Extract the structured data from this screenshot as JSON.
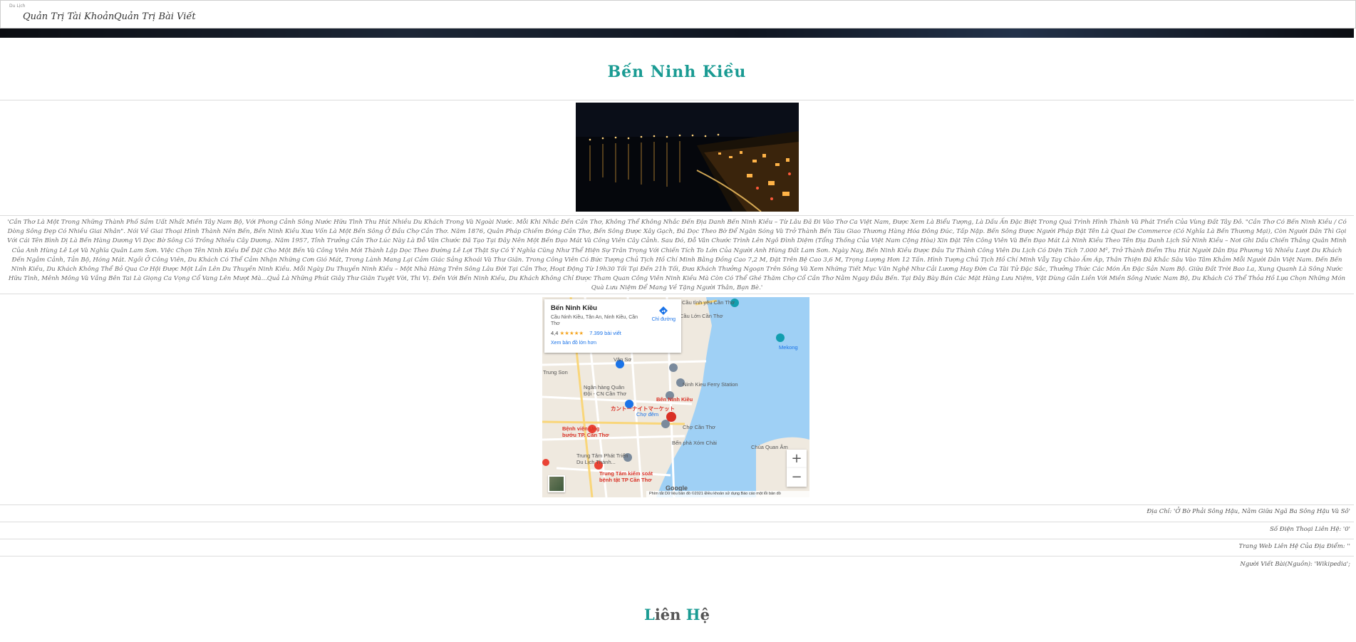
{
  "nav": {
    "brand": "Du Lịch",
    "links": [
      "Quản Trị Tài Khoản",
      "Quản Trị Bài Viết"
    ]
  },
  "page": {
    "title": "Bến Ninh Kiều",
    "description": "'Cần Thơ Là Một Trong Những Thành Phố Sầm Uất Nhất Miền Tây Nam Bộ, Với Phong Cảnh Sông Nước Hữu Tình Thu Hút Nhiều Du Khách Trong Và Ngoài Nước. Mỗi Khi Nhắc Đến Cần Thơ, Không Thể Không Nhắc Đến Địa Danh Bến Ninh Kiều – Từ Lâu Đã Đi Vào Thơ Ca Việt Nam, Được Xem Là Biểu Tượng, Là Dấu Ấn Đặc Biệt Trong Quá Trình Hình Thành Và Phát Triển Của Vùng Đất Tây Đô. \"Cần Thơ Có Bến Ninh Kiều / Có Dòng Sông Đẹp Có Nhiều Giai Nhân\". Nói Về Giai Thoại Hình Thành Nên Bến, Bến Ninh Kiều Xưa Vốn Là Một Bến Sông Ở Đầu Chợ Cần Thơ. Năm 1876, Quân Pháp Chiếm Đóng Cần Thơ, Bến Sông Được Xây Gạch, Đá Dọc Theo Bờ Để Ngăn Sóng Và Trở Thành Bến Tàu Giao Thương Hàng Hóa Đông Đúc, Tấp Nập. Bến Sông Được Người Pháp Đặt Tên Là Quai De Commerce (Có Nghĩa Là Bến Thương Mại), Còn Người Dân Thì Gọi Với Cái Tên Bình Dị Là Bến Hàng Dương Vì Dọc Bờ Sông Có Trồng Nhiều Cây Dương. Năm 1957, Tỉnh Trưởng Cần Thơ Lúc Này Là Đỗ Vân Chước Đã Tạo Tại Đây Nên Một Bến Đạo Mát Và Công Viên Cây Cảnh. Sau Đó, Đỗ Vân Chước Trình Lên Ngô Đình Diệm (Tổng Thống Của Việt Nam Cộng Hòa) Xin Đặt Tên Công Viên Và Bến Đạo Mát Là Ninh Kiều Theo Tên Địa Danh Lịch Sử Ninh Kiều – Nơi Ghi Dấu Chiến Thắng Quân Minh Của Anh Hùng Lê Lợi Và Nghĩa Quân Lam Sơn. Việc Chọn Tên Ninh Kiều Để Đặt Cho Một Bến Và Công Viên Mới Thành Lập Dọc Theo Đường Lê Lợi Thật Sự Có Ý Nghĩa Cũng Như Thể Hiện Sự Trân Trọng Với Chiến Tích To Lớn Của Người Anh Hùng Đất Lam Sơn. Ngày Nay, Bến Ninh Kiều Được Đầu Tư Thành Công Viên Du Lịch Có Diện Tích 7.000 M², Trở Thành Điểm Thu Hút Người Dân Địa Phương Và Nhiều Lượt Du Khách Đến Ngắm Cảnh, Tản Bộ, Hóng Mát. Ngồi Ở Công Viên, Du Khách Có Thể Cảm Nhận Những Cơn Gió Mát, Trong Lành Mang Lại Cảm Giác Sảng Khoái Và Thư Giãn. Trong Công Viên Có Bức Tượng Chủ Tịch Hồ Chí Minh Bằng Đồng Cao 7,2 M, Đặt Trên Bệ Cao 3,6 M, Trọng Lượng Hơn 12 Tấn. Hình Tượng Chủ Tịch Hồ Chí Minh Vẫy Tay Chào Ấm Áp, Thân Thiện Đã Khắc Sâu Vào Tâm Khảm Mỗi Người Dân Việt Nam. Đến Bến Ninh Kiều, Du Khách Không Thể Bỏ Qua Cơ Hội Được Một Lần Lên Du Thuyền Ninh Kiều. Mỗi Ngày Du Thuyền Ninh Kiều – Một Nhà Hàng Trên Sông Lâu Đời Tại Cần Thơ, Hoạt Động Từ 19h30 Tối Tại Đến 21h Tối, Đưa Khách Thưởng Ngoạn Trên Sông Và Xem Những Tiết Mục Văn Nghệ Như Cải Lương Hay Đờn Ca Tài Tử Đặc Sắc, Thưởng Thức Các Món Ăn Đặc Sản Nam Bộ. Giữa Đất Trời Bao La, Xung Quanh Là Sông Nước Hữu Tình, Mênh Mông Và Vắng Bên Tai Là Giọng Ca Vọng Cổ Vang Lên Mượt Mà...Quả Là Những Phút Giây Thư Giãn Tuyệt Vời, Thi Vị. Đến Với Bến Ninh Kiều, Du Khách Không Chỉ Được Tham Quan Công Viên Ninh Kiều Mà Còn Có Thể Ghé Thăm Chợ Cổ Cần Thơ Nằm Ngay Đầu Bến. Tại Đây Bày Bán Các Mặt Hàng Lưu Niệm, Vật Dùng Gắn Liền Với Miền Sông Nước Nam Bộ, Du Khách Có Thể Thỏa Hồ Lựa Chọn Những Món Quà Lưu Niệm Để Mang Về Tặng Người Thân, Bạn Bè.'"
  },
  "map": {
    "card_title": "Bến Ninh Kiều",
    "card_address": "Cầu Ninh Kiều, Tân An, Ninh Kiều, Cần Thơ",
    "rating": "4,4",
    "stars": "★★★★★",
    "reviews": "7.399 bài viết",
    "larger_map": "Xem bản đồ lớn hơn",
    "directions": "Chỉ đường",
    "zoom_in": "+",
    "zoom_out": "−",
    "google": "Google",
    "footer": "Phím tắt   Dữ liệu bản đồ ©2021   Điều khoản sử dụng   Báo cáo một lỗi bản đồ",
    "labels": {
      "mekong": "Mekong",
      "ferry": "Ninh Kieu Ferry Station",
      "ninhkieu": "Bến Ninh Kiều",
      "trungson": "Trung Son",
      "bank": "Ngân hàng Quân Đội - CN Cần Thơ",
      "market_jp": "カントーナイトマーケット",
      "cholon": "Chợ đêm",
      "chocantho": "Chợ Cần Thơ",
      "xomchai": "Bến phà Xóm Chài",
      "hospital": "Bệnh viện Ung bướu TP. Cần Thơ",
      "center": "Trung Tâm Phát Triển Du Lịch Thành...",
      "disease": "Trung Tâm kiểm soát bệnh tật TP Cần Thơ",
      "quanan": "Chùa Quan Âm",
      "love": "Cầu tình yêu Cần Thơ",
      "lon": "Cầu Lớn Cần Thơ",
      "vanso": "Văn Sơ"
    }
  },
  "info": {
    "address": "Địa Chỉ: 'Ở Bờ Phải Sông Hậu, Nằm Giữa Ngã Ba Sông Hậu Và Sô'",
    "phone": "Số Điện Thoại Liên Hệ: '0'",
    "website": "Trang Web Liên Hệ Của Địa Điểm: ''",
    "author": "Người Viết Bài(Nguồn): 'Wikipedia';"
  },
  "contact": {
    "first": "L",
    "mid": "iên ",
    "second": "H",
    "last": "ệ"
  }
}
